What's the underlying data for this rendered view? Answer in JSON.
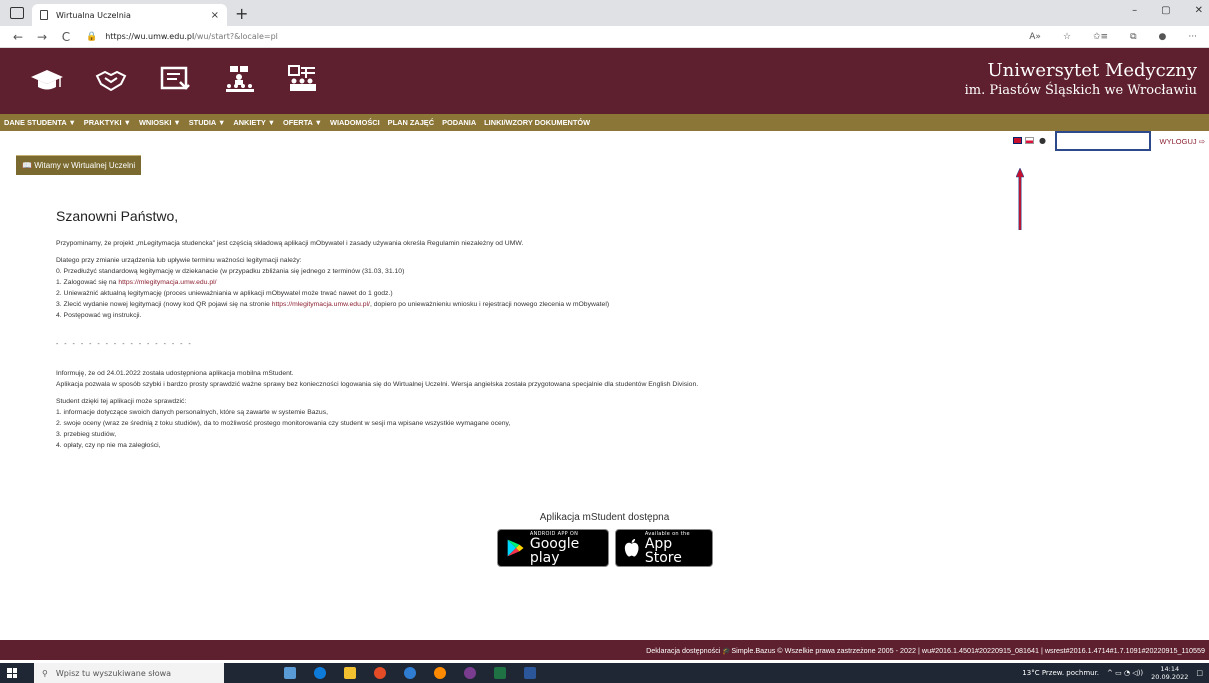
{
  "browser": {
    "tab_title": "Wirtualna Uczelnia",
    "tab_close": "×",
    "new_tab": "+",
    "url_host": "https://wu.umw.edu.pl",
    "url_path": "/wu/start?&locale=pl",
    "win_min": "–",
    "win_max": "▢",
    "win_close": "✕",
    "back": "←",
    "forward": "→",
    "reload": "C",
    "actions": [
      "A»",
      "☆",
      "✩≡",
      "⧉",
      "●",
      "···"
    ]
  },
  "header": {
    "uni_line1": "Uniwersytet Medyczny",
    "uni_line2": "im. Piastów Śląskich we Wrocławiu",
    "icons": [
      "graduation-cap-icon",
      "handshake-icon",
      "document-form-icon",
      "classroom-icon",
      "schedule-board-icon"
    ]
  },
  "menu": [
    "DANE STUDENTA ▼",
    "PRAKTYKI ▼",
    "WNIOSKI ▼",
    "STUDIA ▼",
    "ANKIETY ▼",
    "OFERTA ▼",
    "WIADOMOŚCI",
    "PLAN ZAJĘĆ",
    "PODANIA",
    "LINKI/WZORY DOKUMENTÓW"
  ],
  "toolbar": {
    "logout": "WYLOGUJ ⇨"
  },
  "welcome": "Witamy w Wirtualnej Uczelni",
  "content": {
    "heading": "Szanowni Państwo,",
    "p1": "Przypominamy, że projekt „mLegitymacja studencka\" jest częścią składową aplikacji mObywatel i zasady używania określa Regulamin niezależny od UMW.",
    "p2": "Dlatego przy zmianie urządzenia lub upływie terminu ważności legitymacji należy:",
    "l0": "0. Przedłużyć standardową legitymację w dziekanacie (w przypadku zbliżania się jednego z terminów (31.03, 31.10)",
    "l1a": "1. Zalogować się na ",
    "l1link": "https://mlegitymacja.umw.edu.pl/",
    "l2": "2. Unieważnić aktualną legitymację (proces unieważniania w aplikacji mObywatel może trwać nawet do 1 godz.)",
    "l3a": "3. Zlecić wydanie nowej legitymacji (nowy kod QR pojawi się na stronie ",
    "l3link": "https://mlegitymacja.umw.edu.pl/",
    "l3b": ", dopiero po unieważnieniu wniosku i rejestracji nowego zlecenia w mObywatel)",
    "l4": "4. Postępować wg instrukcji.",
    "dashes": "- - - - - - - - - - - - - - - - -",
    "p3": "Informuję, że od 24.01.2022 została udostępniona aplikacja mobilna mStudent.",
    "p4": "Aplikacja pozwala w sposób szybki i bardzo prosty sprawdzić ważne sprawy bez konieczności logowania się do Wirtualnej Uczelni. Wersja angielska została przygotowana specjalnie dla studentów English Division.",
    "p5": "Student dzięki tej aplikacji może sprawdzić:",
    "s1": "1. informacje dotyczące swoich danych personalnych, które są zawarte w systemie Bazus,",
    "s2": "2. swoje oceny (wraz ze średnią z toku studiów), da to możliwość prostego monitorowania czy student w sesji ma wpisane wszystkie wymagane oceny,",
    "s3": "3. przebieg studiów,",
    "s4": "4. opłaty, czy np nie ma zaległości,"
  },
  "apps": {
    "title": "Aplikacja mStudent dostępna",
    "google_small": "ANDROID APP ON",
    "google_big": "Google play",
    "apple_small": "Available on the",
    "apple_big": "App Store"
  },
  "footer": {
    "text": "Deklaracja dostępności   🎓Simple.Bazus © Wszelkie prawa zastrzeżone 2005 - 2022 | wu#2016.1.4501#20220915_081641 | wsrest#2016.1.4714#1.7.1091#20220915_110559"
  },
  "taskbar": {
    "search": "Wpisz tu wyszukiwane słowa",
    "weather": "13°C  Przew. pochmur.",
    "time": "14:14",
    "date": "20.09.2022"
  },
  "colors": {
    "maroon": "#5e1f2e",
    "gold": "#8b7638",
    "arrow": "#c8102e"
  }
}
